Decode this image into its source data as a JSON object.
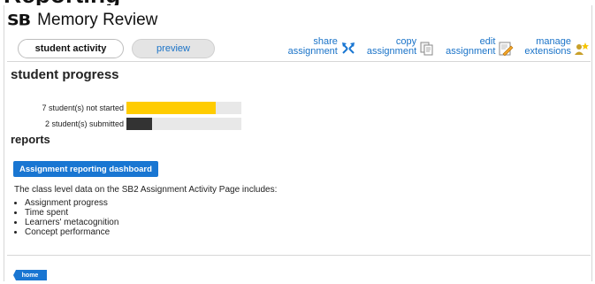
{
  "header": {
    "logo": "SB",
    "title": "Memory Review"
  },
  "tabs": [
    {
      "label": "student activity",
      "active": true
    },
    {
      "label": "preview",
      "active": false
    }
  ],
  "actions": [
    {
      "line1": "share",
      "line2": "assignment",
      "icon": "share-arrows-icon"
    },
    {
      "line1": "copy",
      "line2": "assignment",
      "icon": "copy-documents-icon"
    },
    {
      "line1": "edit",
      "line2": "assignment",
      "icon": "edit-pencil-icon"
    },
    {
      "line1": "manage",
      "line2": "extensions",
      "icon": "person-star-icon"
    }
  ],
  "progress": {
    "heading": "student progress",
    "rows": [
      {
        "label": "7 student(s) not started",
        "fraction": 0.78,
        "color": "#ffcc00"
      },
      {
        "label": "2 student(s) submitted",
        "fraction": 0.22,
        "color": "#333333"
      }
    ]
  },
  "reports": {
    "heading": "reports",
    "button_label": "Assignment reporting dashboard",
    "description": "The class level data on the SB2 Assignment Activity Page includes:",
    "items": [
      "Assignment progress",
      "Time spent",
      "Learners' metacognition",
      "Concept performance"
    ]
  },
  "footer": {
    "home_label": "home"
  },
  "colors": {
    "accent": "#1976d2",
    "link": "#1a73c8"
  }
}
